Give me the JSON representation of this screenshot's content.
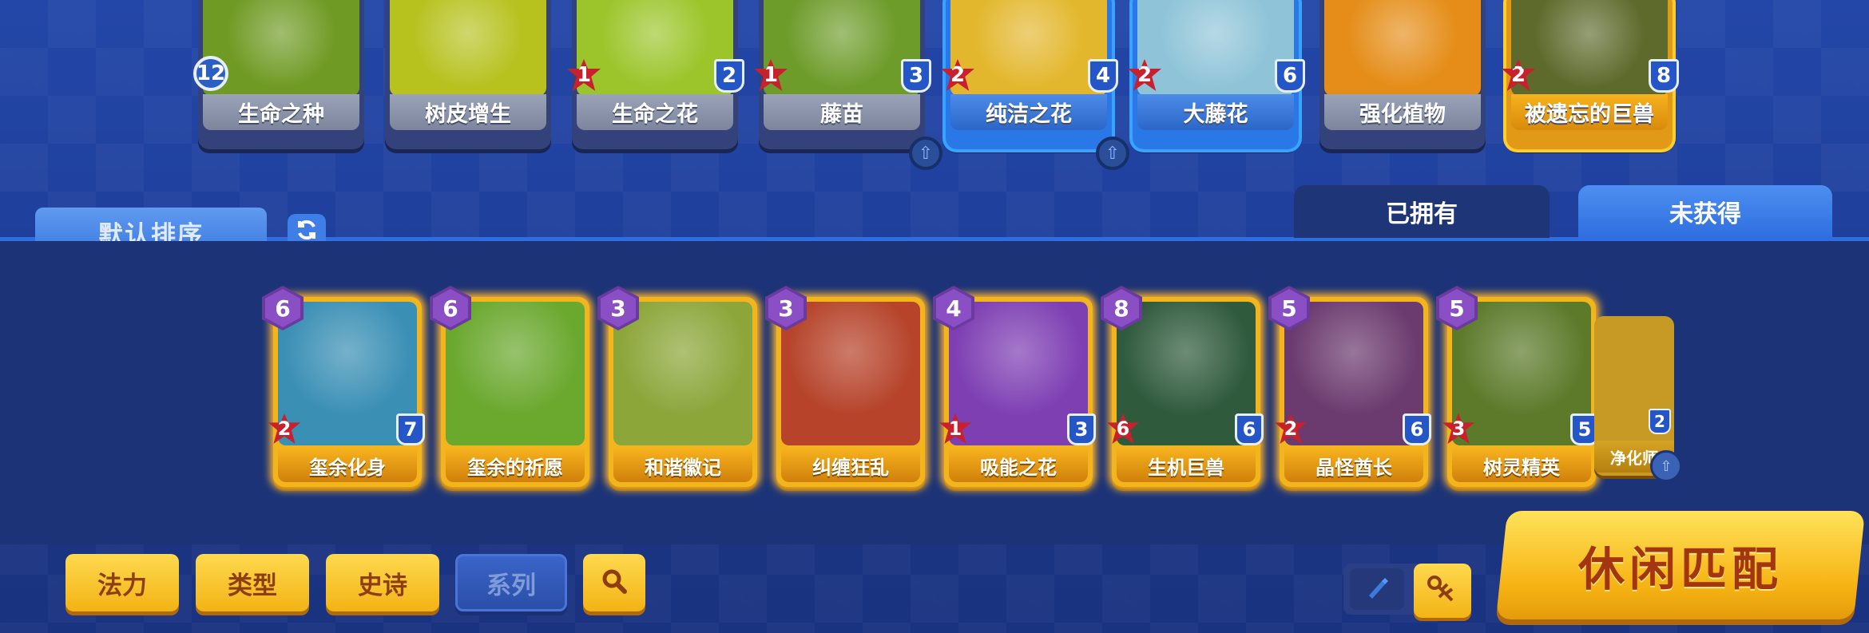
{
  "deck": [
    {
      "name": "生命之种",
      "count": "12",
      "cost_type": "count",
      "hp": null,
      "atk": null,
      "art_color": "#6f9a23",
      "style": "normal",
      "upgrade": false
    },
    {
      "name": "树皮增生",
      "count": null,
      "atk": null,
      "hp": null,
      "art_color": "#b7c21f",
      "style": "normal",
      "upgrade": false
    },
    {
      "name": "生命之花",
      "atk": "1",
      "hp": "2",
      "art_color": "#9bc52a",
      "style": "normal",
      "upgrade": false
    },
    {
      "name": "藤苗",
      "atk": "1",
      "hp": "3",
      "art_color": "#6e9c2b",
      "style": "normal",
      "upgrade": true
    },
    {
      "name": "纯洁之花",
      "atk": "2",
      "hp": "4",
      "art_color": "#e3b72d",
      "style": "highlight",
      "upgrade": true
    },
    {
      "name": "大藤花",
      "atk": "2",
      "hp": "6",
      "art_color": "#8fc4d8",
      "style": "highlight",
      "upgrade": false
    },
    {
      "name": "强化植物",
      "atk": null,
      "hp": null,
      "art_color": "#e58d18",
      "style": "normal",
      "upgrade": false
    },
    {
      "name": "被遗忘的巨兽",
      "atk": "2",
      "hp": "8",
      "art_color": "#5e6a2c",
      "style": "legend",
      "upgrade": false
    }
  ],
  "controls": {
    "sort_label": "默认排序",
    "refresh_icon": "refresh-icon",
    "tabs": [
      {
        "label": "已拥有",
        "active": false
      },
      {
        "label": "未获得",
        "active": true
      }
    ]
  },
  "collection": [
    {
      "name": "玺余化身",
      "cost": "6",
      "atk": "2",
      "hp": "7",
      "art_color": "#3a8fb5"
    },
    {
      "name": "玺余的祈愿",
      "cost": "6",
      "atk": null,
      "hp": null,
      "art_color": "#6aa82e"
    },
    {
      "name": "和谐徽记",
      "cost": "3",
      "atk": null,
      "hp": null,
      "art_color": "#8ca63a"
    },
    {
      "name": "纠缠狂乱",
      "cost": "3",
      "atk": null,
      "hp": null,
      "art_color": "#b6432a"
    },
    {
      "name": "吸能之花",
      "cost": "4",
      "atk": "1",
      "hp": "3",
      "art_color": "#7e3fb3"
    },
    {
      "name": "生机巨兽",
      "cost": "8",
      "atk": "6",
      "hp": "6",
      "art_color": "#2f5a3c"
    },
    {
      "name": "晶怪酋长",
      "cost": "5",
      "atk": "2",
      "hp": "6",
      "art_color": "#6b3a6e"
    },
    {
      "name": "树灵精英",
      "cost": "5",
      "atk": "3",
      "hp": "5",
      "art_color": "#5c7a2a"
    }
  ],
  "partial_card": {
    "name": "净化师",
    "hp": "2"
  },
  "filters": {
    "mana_label": "法力",
    "type_label": "类型",
    "epic_label": "史诗",
    "series_label": "系列",
    "search_icon": "search-icon"
  },
  "match_button": {
    "label": "休闲匹配"
  },
  "colors": {
    "accent_yellow": "#f3b315",
    "panel_blue": "#1c3377",
    "tab_active": "#2f6ee0",
    "cost_purple": "#8a4fc4",
    "atk_red": "#c8202c",
    "hp_blue": "#2456c8"
  }
}
